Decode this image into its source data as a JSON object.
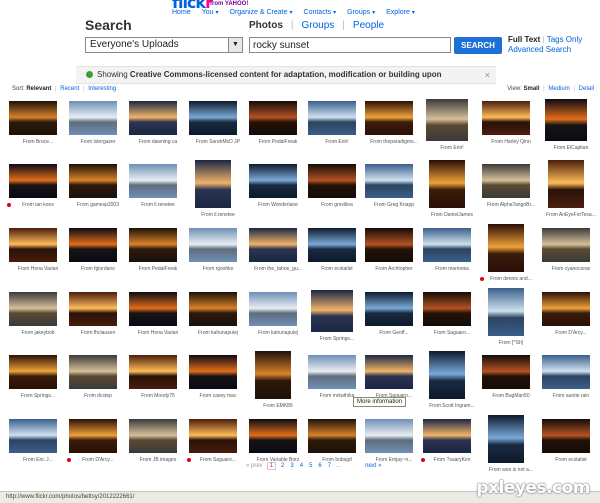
{
  "brand": {
    "logo_text": "flickr",
    "from": "from YAHOO!"
  },
  "nav": {
    "items": [
      "Home",
      "You",
      "Organize & Create",
      "Contacts",
      "Groups",
      "Explore"
    ]
  },
  "search": {
    "heading": "Search",
    "tabs": {
      "photos": "Photos",
      "groups": "Groups",
      "people": "People"
    },
    "scope_value": "Everyone's Uploads",
    "query": "rocky sunset",
    "button": "SEARCH",
    "full_text": "Full Text",
    "tags_only": "Tags Only",
    "advanced": "Advanced Search"
  },
  "notice": {
    "prefix": "Showing ",
    "bold": "Creative Commons-licensed content for adaptation, modification or building upon",
    "close": "×"
  },
  "sort": {
    "label": "Sort:",
    "options": [
      "Relevant",
      "Recent",
      "Interesting"
    ],
    "active": "Relevant"
  },
  "view": {
    "label": "View:",
    "options": [
      "Small",
      "Medium",
      "Detail"
    ],
    "active": "Small"
  },
  "tooltip": "More information",
  "photos": [
    {
      "owner": "From Bruce..."
    },
    {
      "owner": "From lstergazer"
    },
    {
      "owner": "From dawning.ca"
    },
    {
      "owner": "From SarahMcD JP"
    },
    {
      "owner": "From PedalFreak"
    },
    {
      "owner": "From Erin!"
    },
    {
      "owner": "From theparadigms..."
    },
    {
      "owner": "From Erin!"
    },
    {
      "owner": "From Harley Qinn"
    },
    {
      "owner": "From ElCapitan"
    },
    {
      "owner": "From ian koos"
    },
    {
      "owner": "From gamesp2003"
    },
    {
      "owner": "From il.renetee"
    },
    {
      "owner": "From il.renetee"
    },
    {
      "owner": "From Wonderlane"
    },
    {
      "owner": "From grevillea"
    },
    {
      "owner": "From Greg Knapp"
    },
    {
      "owner": "From DanielJames"
    },
    {
      "owner": "From AlphaTangoBr..."
    },
    {
      "owner": "From AnEyeForTexa..."
    },
    {
      "owner": "From Hona Varian"
    },
    {
      "owner": "From fgiordano"
    },
    {
      "owner": "From PedalFreak"
    },
    {
      "owner": "From rgoshko"
    },
    {
      "owner": "From the_tahoe_gu..."
    },
    {
      "owner": "From ecstatist"
    },
    {
      "owner": "From Archtopher"
    },
    {
      "owner": "From marionka"
    },
    {
      "owner": "From dennis and..."
    },
    {
      "owner": "From cyanocorax"
    },
    {
      "owner": "From jakeybob"
    },
    {
      "owner": "From fhclausen"
    },
    {
      "owner": "From Hona Varian"
    },
    {
      "owner": "From kahunapulej"
    },
    {
      "owner": "From kahunapulej"
    },
    {
      "owner": "From Springs..."
    },
    {
      "owner": "From Geoff..."
    },
    {
      "owner": "From Saguaro..."
    },
    {
      "owner": "From [^Sh]"
    },
    {
      "owner": "From D'Arcy..."
    },
    {
      "owner": "From Springs..."
    },
    {
      "owner": "From dcstep"
    },
    {
      "owner": "From Moody75"
    },
    {
      "owner": "From casey mac"
    },
    {
      "owner": "From EMK89"
    },
    {
      "owner": "From mrkathika"
    },
    {
      "owner": "From Saguaro..."
    },
    {
      "owner": "From Scott Ingram..."
    },
    {
      "owner": "From BugMan50"
    },
    {
      "owner": "From auntie rain"
    },
    {
      "owner": "From Eric J..."
    },
    {
      "owner": "From D'Arcy..."
    },
    {
      "owner": "From JB images"
    },
    {
      "owner": "From Saguaro..."
    },
    {
      "owner": "From Variable Borz"
    },
    {
      "owner": "From bobsgd"
    },
    {
      "owner": "From Emjay~n..."
    },
    {
      "owner": "From ?saaryKen"
    },
    {
      "owner": "From woo is not a..."
    },
    {
      "owner": "From ecstatist"
    }
  ],
  "pagination": {
    "prev": "« prev",
    "pages": [
      "1",
      "2",
      "3",
      "4",
      "5",
      "6",
      "7"
    ],
    "current": "1",
    "ellipsis": "...",
    "next": "next »"
  },
  "status_url": "http://www.flickr.com/photos/bettsy/2012222661/",
  "watermark": "pxleyes.com",
  "colors": {
    "flickr_blue": "#0063dc",
    "flickr_pink": "#ff0084",
    "search_button": "#1e6fd6",
    "cc_green": "#3aa13a",
    "badge_red": "#e0001c"
  }
}
